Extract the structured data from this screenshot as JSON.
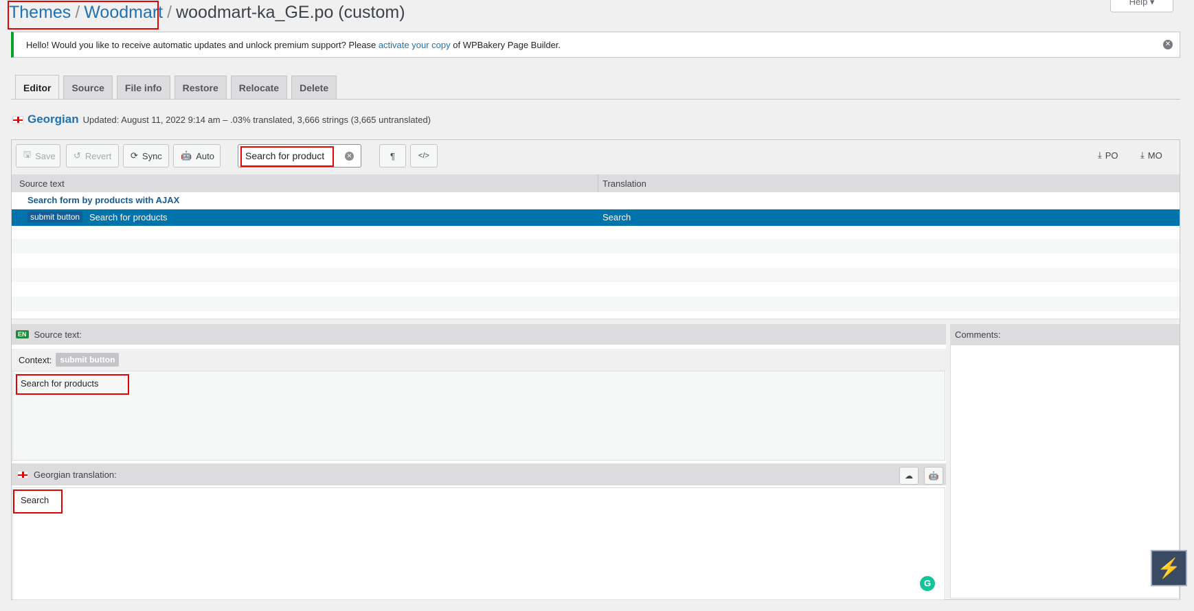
{
  "breadcrumb": {
    "themes": "Themes",
    "woodmart": "Woodmart",
    "file": "woodmart-ka_GE.po (custom)"
  },
  "help_label": "Help ▾",
  "notice": {
    "text_before": "Hello! Would you like to receive automatic updates and unlock premium support? Please ",
    "link": "activate your copy",
    "text_after": " of WPBakery Page Builder."
  },
  "tabs": [
    "Editor",
    "Source",
    "File info",
    "Restore",
    "Relocate",
    "Delete"
  ],
  "status": {
    "language": "Georgian",
    "summary": "Updated: August 11, 2022 9:14 am – .03% translated, 3,666 strings (3,665 untranslated)"
  },
  "toolbar": {
    "save": "Save",
    "revert": "Revert",
    "sync": "Sync",
    "auto": "Auto",
    "search_value": "Search for product",
    "po": "PO",
    "mo": "MO"
  },
  "grid": {
    "col_source": "Source text",
    "col_translation": "Translation",
    "group_row": "Search form by products with AJAX",
    "selected": {
      "context": "submit button",
      "source": "Search for products",
      "translation": "Search"
    }
  },
  "source_pane": {
    "badge": "EN",
    "label": "Source text:",
    "context_label": "Context:",
    "context_value": "submit button",
    "text": "Search for products"
  },
  "translation_pane": {
    "label": "Georgian translation:",
    "text": "Search"
  },
  "comments_label": "Comments:"
}
